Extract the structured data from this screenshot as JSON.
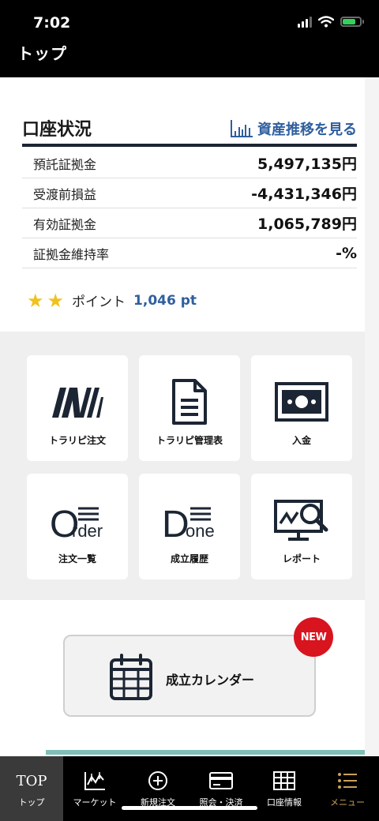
{
  "status_bar": {
    "time": "7:02"
  },
  "header": {
    "title": "トップ"
  },
  "account": {
    "title": "口座状況",
    "history_link": "資産推移を見る",
    "rows": [
      {
        "label": "預託証拠金",
        "value": "5,497,135円"
      },
      {
        "label": "受渡前損益",
        "value": "-4,431,346円"
      },
      {
        "label": "有効証拠金",
        "value": "1,065,789円"
      },
      {
        "label": "証拠金維持率",
        "value": "-%"
      }
    ],
    "points": {
      "label": "ポイント",
      "value": "1,046 pt",
      "stars": 2
    }
  },
  "tiles": [
    {
      "label": "トラリピ注文",
      "icon": "trarepi-logo-icon"
    },
    {
      "label": "トラリピ管理表",
      "icon": "document-icon"
    },
    {
      "label": "入金",
      "icon": "banknote-icon"
    },
    {
      "label": "注文一覧",
      "icon": "order-list-icon",
      "big": "O",
      "small": "rder"
    },
    {
      "label": "成立履歴",
      "icon": "done-history-icon",
      "big": "D",
      "small": "one"
    },
    {
      "label": "レポート",
      "icon": "report-magnifier-icon"
    }
  ],
  "calendar": {
    "label": "成立カレンダー",
    "badge": "NEW"
  },
  "bottom_nav": [
    {
      "label": "トップ",
      "icon_text": "TOP",
      "active": true
    },
    {
      "label": "マーケット",
      "icon": "market-chart-icon"
    },
    {
      "label": "新規注文",
      "icon": "plus-circle-icon"
    },
    {
      "label": "照会・決済",
      "icon": "card-icon"
    },
    {
      "label": "口座情報",
      "icon": "table-icon"
    },
    {
      "label": "メニュー",
      "icon": "menu-list-icon"
    }
  ],
  "colors": {
    "accent_blue": "#2f5f9e",
    "navy": "#1c2533",
    "badge_red": "#d8141f",
    "star": "#f2c11b",
    "menu_gold": "#caa05a"
  }
}
